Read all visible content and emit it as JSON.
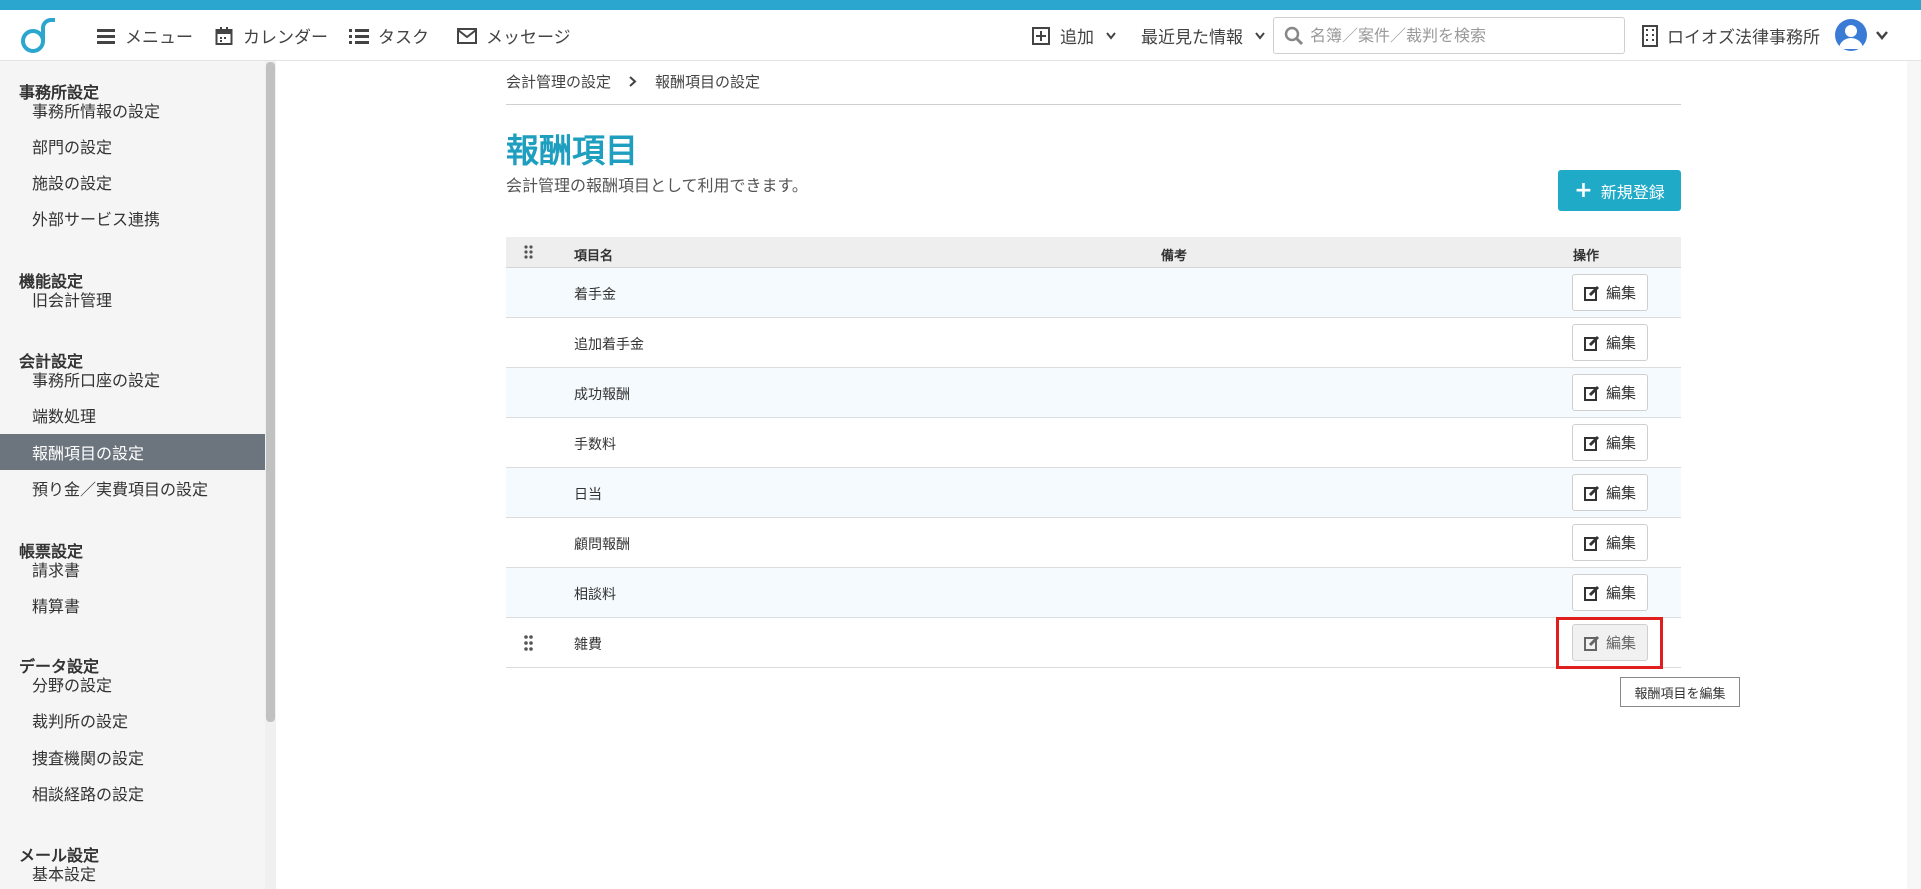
{
  "header": {
    "nav": [
      {
        "label": "メニュー",
        "icon": "hamburger-icon"
      },
      {
        "label": "カレンダー",
        "icon": "calendar-icon"
      },
      {
        "label": "タスク",
        "icon": "list-icon"
      },
      {
        "label": "メッセージ",
        "icon": "envelope-icon"
      }
    ],
    "add_label": "追加",
    "recent_label": "最近見た情報",
    "search_placeholder": "名簿／案件／裁判を検索",
    "office_name": "ロイオズ法律事務所",
    "accent_color": "#2aa6cf"
  },
  "sidebar": {
    "sections": [
      {
        "title": "事務所設定",
        "items": [
          "事務所情報の設定",
          "部門の設定",
          "施設の設定",
          "外部サービス連携"
        ]
      },
      {
        "title": "機能設定",
        "items": [
          "旧会計管理"
        ]
      },
      {
        "title": "会計設定",
        "items": [
          "事務所口座の設定",
          "端数処理",
          "報酬項目の設定",
          "預り金／実費項目の設定"
        ]
      },
      {
        "title": "帳票設定",
        "items": [
          "請求書",
          "精算書"
        ]
      },
      {
        "title": "データ設定",
        "items": [
          "分野の設定",
          "裁判所の設定",
          "捜査機関の設定",
          "相談経路の設定"
        ]
      },
      {
        "title": "メール設定",
        "items": [
          "基本設定"
        ]
      }
    ],
    "active_item": "報酬項目の設定"
  },
  "breadcrumb": {
    "parent": "会計管理の設定",
    "current": "報酬項目の設定"
  },
  "page": {
    "title": "報酬項目",
    "description": "会計管理の報酬項目として利用できます。",
    "new_button": "新規登録"
  },
  "table": {
    "columns": {
      "name": "項目名",
      "note": "備考",
      "action": "操作"
    },
    "rows": [
      "着手金",
      "追加着手金",
      "成功報酬",
      "手数料",
      "日当",
      "顧問報酬",
      "相談料",
      "雑費"
    ],
    "edit_label": "編集"
  },
  "tooltip": "報酬項目を編集"
}
